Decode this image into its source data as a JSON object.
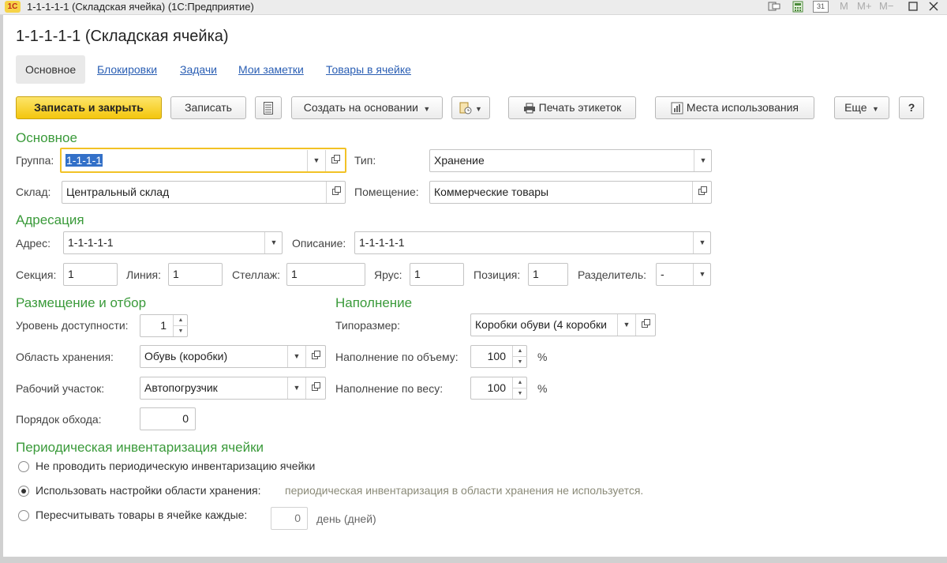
{
  "window": {
    "logo": "1С",
    "title": "1-1-1-1-1 (Складская ячейка)  (1С:Предприятие)",
    "tb_m": "M",
    "tb_mplus": "M+",
    "tb_mminus": "M−",
    "calendar_num": "31"
  },
  "page_title": "1-1-1-1-1 (Складская ячейка)",
  "tabs": [
    "Основное",
    "Блокировки",
    "Задачи",
    "Мои заметки",
    "Товары в ячейке"
  ],
  "toolbar": {
    "save_close": "Записать и закрыть",
    "save": "Записать",
    "create_based": "Создать на основании",
    "print_labels": "Печать этикеток",
    "usage_places": "Места использования",
    "more": "Еще",
    "help": "?"
  },
  "sections": {
    "main": "Основное",
    "addressing": "Адресация",
    "placement": "Размещение и отбор",
    "filling": "Наполнение",
    "inventory": "Периодическая инвентаризация ячейки"
  },
  "main": {
    "group_label": "Группа:",
    "group_value": "1-1-1-1",
    "type_label": "Тип:",
    "type_value": "Хранение",
    "warehouse_label": "Склад:",
    "warehouse_value": "Центральный склад",
    "room_label": "Помещение:",
    "room_value": "Коммерческие товары"
  },
  "addressing": {
    "address_label": "Адрес:",
    "address_value": "1-1-1-1-1",
    "description_label": "Описание:",
    "description_value": "1-1-1-1-1",
    "section_label": "Секция:",
    "section_value": "1",
    "line_label": "Линия:",
    "line_value": "1",
    "rack_label": "Стеллаж:",
    "rack_value": "1",
    "tier_label": "Ярус:",
    "tier_value": "1",
    "position_label": "Позиция:",
    "position_value": "1",
    "separator_label": "Разделитель:",
    "separator_value": "-"
  },
  "placement": {
    "access_level_label": "Уровень доступности:",
    "access_level_value": "1",
    "storage_area_label": "Область хранения:",
    "storage_area_value": "Обувь (коробки)",
    "work_area_label": "Рабочий участок:",
    "work_area_value": "Автопогрузчик",
    "bypass_order_label": "Порядок обхода:",
    "bypass_order_value": "0"
  },
  "filling": {
    "size_label": "Типоразмер:",
    "size_value": "Коробки обуви (4 коробки",
    "by_volume_label": "Наполнение по объему:",
    "by_volume_value": "100",
    "by_weight_label": "Наполнение по весу:",
    "by_weight_value": "100",
    "percent": "%"
  },
  "inventory": {
    "option_none": "Не проводить периодическую инвентаризацию ячейки",
    "option_area": "Использовать настройки области хранения:",
    "option_area_hint": "периодическая инвентаризация в области хранения не используется.",
    "option_recount": "Пересчитывать товары в ячейке каждые:",
    "recount_value": "0",
    "recount_unit": "день (дней)",
    "selected": "option_area"
  }
}
